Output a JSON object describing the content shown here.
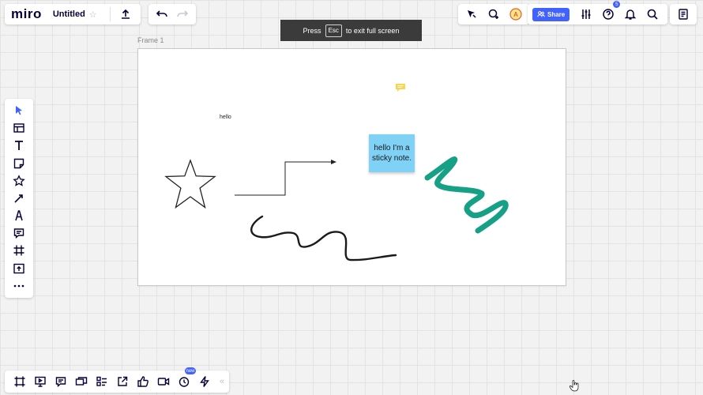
{
  "app": {
    "logo": "miro",
    "board_title": "Untitled",
    "star_glyph": "☆"
  },
  "toast": {
    "press": "Press",
    "key": "Esc",
    "rest": "to exit full screen"
  },
  "header": {
    "share_label": "Share",
    "help_badge": "5"
  },
  "frame": {
    "label": "Frame 1"
  },
  "canvas": {
    "text": "hello",
    "sticky_note": "hello I'm a sticky note."
  },
  "colors": {
    "accent": "#4262ff",
    "sticky": "#7fd1f5",
    "marker": "#16a085",
    "comment": "#fcd34d"
  },
  "left_toolbar": {
    "tools": [
      "select-arrow-icon",
      "templates-icon",
      "text-icon",
      "sticky-note-icon",
      "shapes-icon",
      "connection-line-icon",
      "pen-icon",
      "comment-icon",
      "frame-icon",
      "upload-icon",
      "more-icon"
    ]
  },
  "bottom_toolbar": {
    "tools": [
      "frames-icon",
      "presentation-icon",
      "comments-icon",
      "cards-icon",
      "kanban-icon",
      "share-screen-icon",
      "reactions-icon",
      "video-call-icon",
      "timer-icon",
      "apps-lightning-icon"
    ],
    "new_badge": "new",
    "collapse_glyph": "«"
  }
}
